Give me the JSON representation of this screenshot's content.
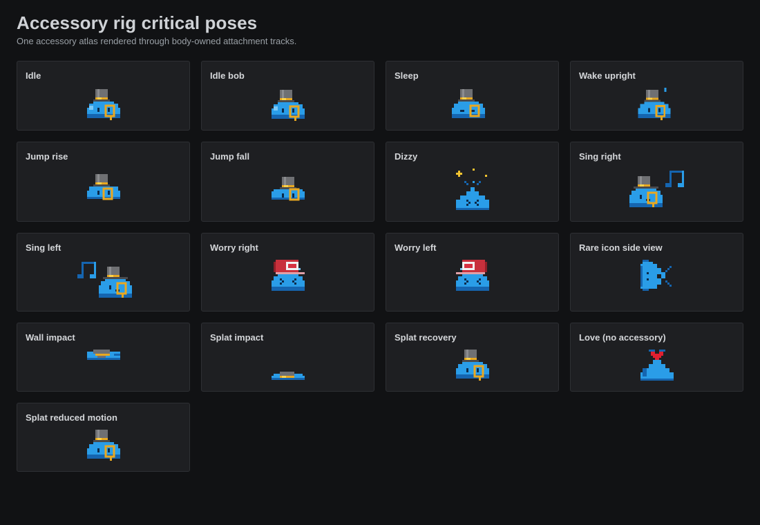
{
  "header": {
    "title": "Accessory rig critical poses",
    "subtitle": "One accessory atlas rendered through body-owned attachment tracks."
  },
  "colors": {
    "background": "#111214",
    "card": "#1e1f22",
    "card_border": "#2e3034",
    "body_blue": "#2a9de8",
    "body_shadow": "#1565b0",
    "hat_gray": "#6f7073",
    "hat_band": "#e9a820",
    "cap_red": "#c8303c",
    "heart_red": "#e02030",
    "spark_yellow": "#f4c430"
  },
  "cards": [
    {
      "label": "Idle",
      "sprite": "slime-tophat-idle"
    },
    {
      "label": "Idle bob",
      "sprite": "slime-tophat-idle-bob"
    },
    {
      "label": "Sleep",
      "sprite": "slime-tophat-sleep"
    },
    {
      "label": "Wake upright",
      "sprite": "slime-tophat-wake"
    },
    {
      "label": "Jump rise",
      "sprite": "slime-tophat-jump-rise"
    },
    {
      "label": "Jump fall",
      "sprite": "slime-tophat-jump-fall"
    },
    {
      "label": "Dizzy",
      "sprite": "slime-dizzy"
    },
    {
      "label": "Sing right",
      "sprite": "slime-tophat-sing-right"
    },
    {
      "label": "Sing left",
      "sprite": "slime-tophat-sing-left"
    },
    {
      "label": "Worry right",
      "sprite": "slime-cap-worry-right"
    },
    {
      "label": "Worry left",
      "sprite": "slime-cap-worry-left"
    },
    {
      "label": "Rare icon side view",
      "sprite": "slime-side-view"
    },
    {
      "label": "Wall impact",
      "sprite": "slime-wall-impact"
    },
    {
      "label": "Splat impact",
      "sprite": "slime-splat-impact"
    },
    {
      "label": "Splat recovery",
      "sprite": "slime-tophat-splat-recovery"
    },
    {
      "label": "Love (no accessory)",
      "sprite": "slime-love"
    },
    {
      "label": "Splat reduced motion",
      "sprite": "slime-tophat-reduced-motion"
    }
  ]
}
